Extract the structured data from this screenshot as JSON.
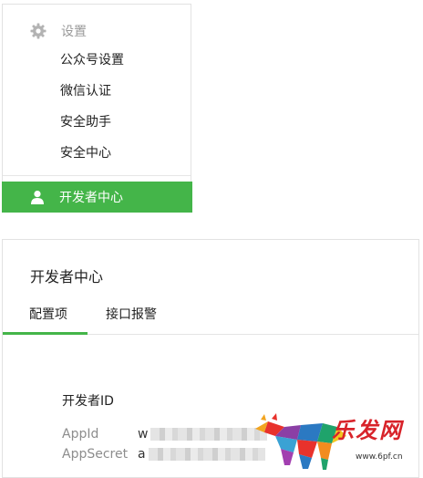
{
  "sidebar": {
    "group_label": "设置",
    "items": [
      {
        "label": "公众号设置"
      },
      {
        "label": "微信认证"
      },
      {
        "label": "安全助手"
      },
      {
        "label": "安全中心"
      }
    ],
    "active_item": {
      "label": "开发者中心"
    },
    "accent_color": "#44b549"
  },
  "main": {
    "title": "开发者中心",
    "tabs": [
      {
        "label": "配置项",
        "active": true
      },
      {
        "label": "接口报警",
        "active": false
      }
    ],
    "section_title": "开发者ID",
    "fields": [
      {
        "label": "AppId",
        "value_prefix": "w"
      },
      {
        "label": "AppSecret",
        "value_prefix": "a"
      }
    ]
  },
  "watermark": {
    "text": "乐发网",
    "url": "www.6pf.cn"
  }
}
